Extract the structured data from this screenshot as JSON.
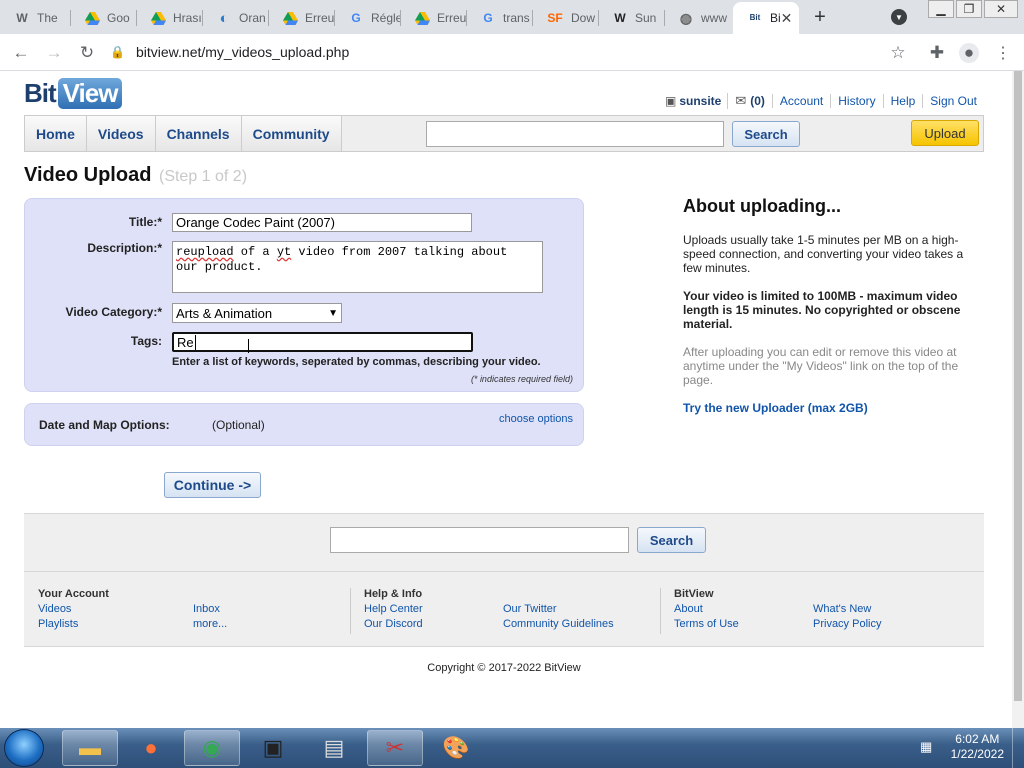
{
  "browser": {
    "tabs": [
      {
        "icon": "W",
        "title": "The"
      },
      {
        "icon": "drive",
        "title": "Goo"
      },
      {
        "icon": "drive",
        "title": "Hrası"
      },
      {
        "icon": "orange",
        "title": "Oran"
      },
      {
        "icon": "drive",
        "title": "Erreu"
      },
      {
        "icon": "G",
        "title": "Régle"
      },
      {
        "icon": "drive",
        "title": "Erreu"
      },
      {
        "icon": "G",
        "title": "trans"
      },
      {
        "icon": "SF",
        "title": "Dow"
      },
      {
        "icon": "W",
        "title": "Sun"
      },
      {
        "icon": "globe",
        "title": "www"
      }
    ],
    "active_tab": {
      "icon": "BitView",
      "title": "Bi"
    },
    "new_tab": "+",
    "url": "bitview.net/my_videos_upload.php"
  },
  "site": {
    "logo_bit": "Bit",
    "logo_view": "View",
    "user": {
      "name": "sunsite",
      "inbox": "(0)",
      "links": [
        "Account",
        "History",
        "Help",
        "Sign Out"
      ]
    },
    "nav": [
      "Home",
      "Videos",
      "Channels",
      "Community"
    ],
    "search_label": "Search",
    "upload_label": "Upload"
  },
  "page": {
    "title": "Video Upload",
    "step": "(Step 1 of 2)",
    "form": {
      "title_label": "Title:*",
      "title_value": "Orange Codec Paint (2007)",
      "desc_label": "Description:*",
      "desc_value_w1": "reupload",
      "desc_value_mid": " of a ",
      "desc_value_w2": "yt",
      "desc_value_rest": " video from 2007 talking about\nour product.",
      "category_label": "Video Category:*",
      "category_value": "Arts & Animation",
      "tags_label": "Tags:",
      "tags_value": "Re",
      "tags_hint": "Enter a list of keywords, seperated by commas, describing your video.",
      "required_note": "(* indicates required field)"
    },
    "date_map": {
      "label": "Date and Map Options:",
      "optional": "(Optional)",
      "link": "choose options"
    },
    "continue_label": "Continue ->",
    "about": {
      "heading": "About uploading...",
      "p1": "Uploads usually take 1-5 minutes per MB on a high-speed connection, and converting your video takes a few minutes.",
      "p2": "Your video is limited to 100MB - maximum video length is 15 minutes. No copyrighted or obscene material.",
      "p3": "After uploading you can edit or remove this video at anytime under the \"My Videos\" link on the top of the page.",
      "link": "Try the new Uploader (max 2GB)"
    }
  },
  "footer": {
    "search_label": "Search",
    "sections": [
      {
        "heading": "Your Account",
        "links": [
          "Videos",
          "Playlists",
          "Inbox",
          "more..."
        ]
      },
      {
        "heading": "Help & Info",
        "links": [
          "Help Center",
          "Our Discord",
          "Our Twitter",
          "Community Guidelines"
        ]
      },
      {
        "heading": "BitView",
        "links": [
          "About",
          "Terms of Use",
          "What's New",
          "Privacy Policy"
        ]
      }
    ],
    "copyright": "Copyright © 2017-2022 BitView"
  },
  "taskbar": {
    "time": "6:02 AM",
    "date": "1/22/2022"
  }
}
